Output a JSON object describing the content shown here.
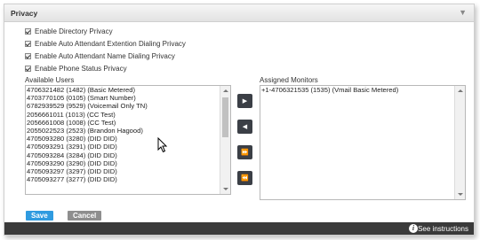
{
  "panel": {
    "title": "Privacy"
  },
  "options": [
    {
      "label": "Enable Directory Privacy",
      "checked": true
    },
    {
      "label": "Enable Auto Attendant Extention Dialing Privacy",
      "checked": true
    },
    {
      "label": "Enable Auto Attendant Name Dialing Privacy",
      "checked": true
    },
    {
      "label": "Enable Phone Status Privacy",
      "checked": true
    }
  ],
  "available_users": {
    "label": "Available Users",
    "items": [
      "4706321482 (1482) (Basic Metered)",
      "4703770105 (0105) (Smart Number)",
      "6782939529 (9529) (Voicemail Only TN)",
      "2056661011 (1013) (CC Test)",
      "2056661008 (1008) (CC Test)",
      "2055022523 (2523) (Brandon Hagood)",
      "4705093280 (3280) (DID DID)",
      "4705093291 (3291) (DID DID)",
      "4705093284 (3284) (DID DID)",
      "4705093290 (3290) (DID DID)",
      "4705093297 (3297) (DID DID)",
      "4705093277 (3277) (DID DID)"
    ]
  },
  "assigned_monitors": {
    "label": "Assigned Monitors",
    "items": [
      "+1-4706321535 (1535) (Vmail Basic Metered)"
    ]
  },
  "move_buttons": [
    {
      "name": "move-right-button",
      "glyph": "▶"
    },
    {
      "name": "move-left-button",
      "glyph": "◀"
    },
    {
      "name": "move-all-right-button",
      "glyph": "⏩"
    },
    {
      "name": "move-all-left-button",
      "glyph": "⏪"
    }
  ],
  "actions": {
    "save": "Save",
    "cancel": "Cancel"
  },
  "footer": {
    "instructions": "See instructions",
    "info_glyph": "i"
  },
  "colors": {
    "save": "#2f9be0",
    "cancel": "#8e8e8e",
    "footer": "#3a3a3a",
    "move_button": "#3b3f46"
  }
}
